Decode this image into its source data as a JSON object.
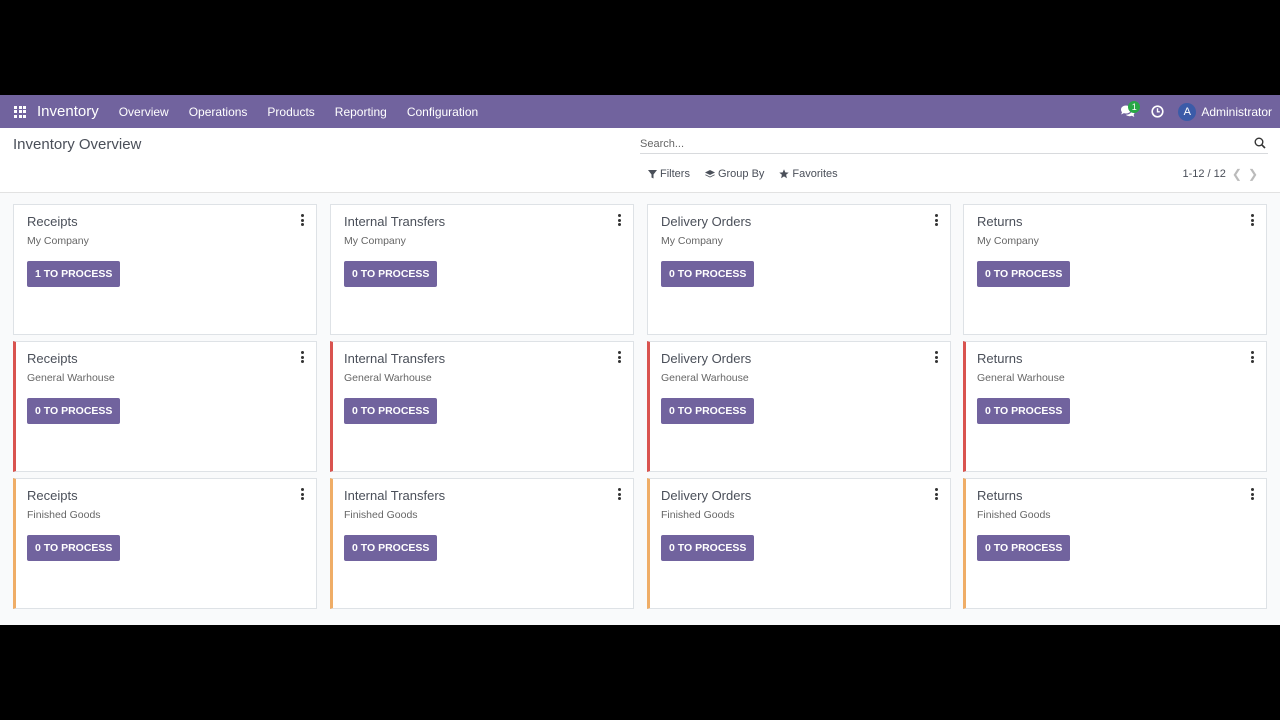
{
  "navbar": {
    "app_name": "Inventory",
    "menu": [
      "Overview",
      "Operations",
      "Products",
      "Reporting",
      "Configuration"
    ],
    "chat_badge": "1",
    "user_initial": "A",
    "user_name": "Administrator",
    "bg_color": "#71639e"
  },
  "control": {
    "title": "Inventory Overview",
    "search_placeholder": "Search...",
    "filters_label": "Filters",
    "group_by_label": "Group By",
    "favorites_label": "Favorites",
    "pager": "1-12 / 12"
  },
  "cards": [
    {
      "title": "Receipts",
      "sub": "My Company",
      "button": "1 TO PROCESS",
      "status": "none"
    },
    {
      "title": "Internal Transfers",
      "sub": "My Company",
      "button": "0 TO PROCESS",
      "status": "none"
    },
    {
      "title": "Delivery Orders",
      "sub": "My Company",
      "button": "0 TO PROCESS",
      "status": "none"
    },
    {
      "title": "Returns",
      "sub": "My Company",
      "button": "0 TO PROCESS",
      "status": "none"
    },
    {
      "title": "Receipts",
      "sub": "General Warhouse",
      "button": "0 TO PROCESS",
      "status": "red"
    },
    {
      "title": "Internal Transfers",
      "sub": "General Warhouse",
      "button": "0 TO PROCESS",
      "status": "red"
    },
    {
      "title": "Delivery Orders",
      "sub": "General Warhouse",
      "button": "0 TO PROCESS",
      "status": "red"
    },
    {
      "title": "Returns",
      "sub": "General Warhouse",
      "button": "0 TO PROCESS",
      "status": "red"
    },
    {
      "title": "Receipts",
      "sub": "Finished Goods",
      "button": "0 TO PROCESS",
      "status": "orange"
    },
    {
      "title": "Internal Transfers",
      "sub": "Finished Goods",
      "button": "0 TO PROCESS",
      "status": "orange"
    },
    {
      "title": "Delivery Orders",
      "sub": "Finished Goods",
      "button": "0 TO PROCESS",
      "status": "orange"
    },
    {
      "title": "Returns",
      "sub": "Finished Goods",
      "button": "0 TO PROCESS",
      "status": "orange"
    }
  ],
  "colors": {
    "accent": "#71639e",
    "red": "#d9534f",
    "orange": "#efad67"
  },
  "icons": {
    "apps": "apps-grid-icon",
    "chat": "chat-icon",
    "clock": "clock-icon",
    "search": "search-icon",
    "filter": "filter-icon",
    "group": "layers-icon",
    "favorite": "star-icon"
  }
}
